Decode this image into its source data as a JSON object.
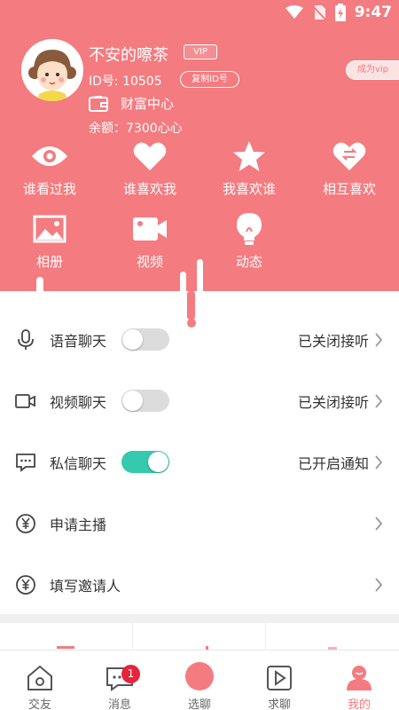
{
  "status_bar": {
    "time": "9:47"
  },
  "profile": {
    "username": "不安的嚓茶",
    "vip_badge": "VIP",
    "id_text": "ID号: 10505",
    "copy_id_label": "复制ID号",
    "wealth_center": "财富中心",
    "balance": "余额：7300心心",
    "become_vip": "成为vip"
  },
  "grid": [
    {
      "label": "谁看过我",
      "icon": "eye-icon"
    },
    {
      "label": "谁喜欢我",
      "icon": "heart-icon"
    },
    {
      "label": "我喜欢谁",
      "icon": "star-icon"
    },
    {
      "label": "相互喜欢",
      "icon": "mutual-heart-icon"
    },
    {
      "label": "相册",
      "icon": "image-icon"
    },
    {
      "label": "视频",
      "icon": "video-icon"
    },
    {
      "label": "动态",
      "icon": "bulb-icon"
    }
  ],
  "menu": [
    {
      "label": "语音聊天",
      "status": "已关闭接听",
      "toggle_on": false,
      "icon": "microphone-icon"
    },
    {
      "label": "视频聊天",
      "status": "已关闭接听",
      "toggle_on": false,
      "icon": "video-call-icon"
    },
    {
      "label": "私信聊天",
      "status": "已开启通知",
      "toggle_on": true,
      "icon": "message-icon"
    },
    {
      "label": "申请主播",
      "icon": "yen-icon"
    },
    {
      "label": "填写邀请人",
      "icon": "yen-icon"
    }
  ],
  "tabs": [
    {
      "label": "交友",
      "icon": "home-icon"
    },
    {
      "label": "消息",
      "icon": "chat-icon",
      "badge": "1"
    },
    {
      "label": "选聊",
      "icon": "select-circle-icon"
    },
    {
      "label": "求聊",
      "icon": "play-icon"
    },
    {
      "label": "我的",
      "icon": "profile-icon",
      "active": true
    }
  ],
  "colors": {
    "primary": "#f47b7f",
    "toggle_on": "#35c9ad",
    "badge": "#e8233c"
  }
}
